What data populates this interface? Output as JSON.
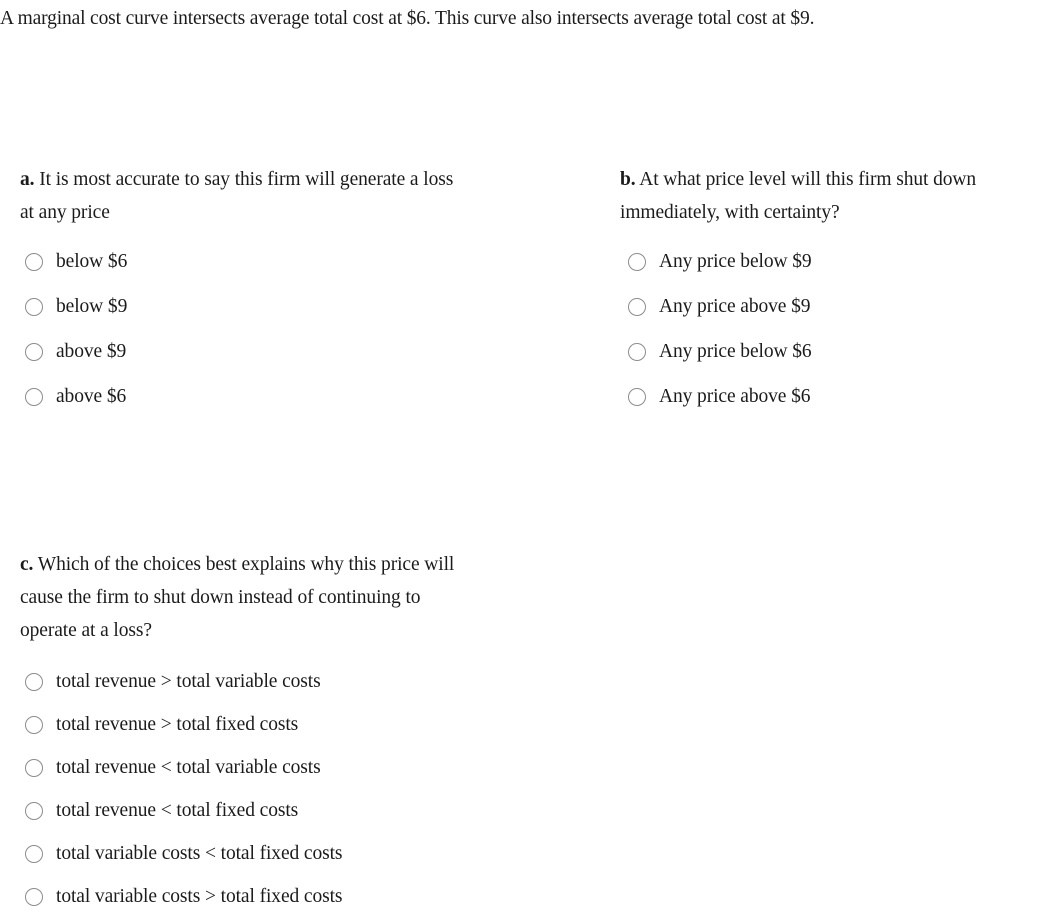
{
  "prompt": "A marginal cost curve intersects average total cost at $6. This curve also intersects average total cost at $9.",
  "questions": [
    {
      "tag": "a.",
      "stem_lines": [
        "It is most accurate to say this firm will generate a loss",
        "at any price"
      ],
      "options": [
        "below $6",
        "below $9",
        "above $9",
        "above $6"
      ]
    },
    {
      "tag": "b.",
      "stem_lines": [
        "At what price level will this firm shut down",
        "immediately, with certainty?"
      ],
      "options": [
        "Any price below $9",
        "Any price above $9",
        "Any price below $6",
        "Any price above $6"
      ]
    },
    {
      "tag": "c.",
      "stem_lines": [
        "Which of the choices best explains why this price will",
        "cause the firm to shut down instead of continuing to",
        "operate at a loss?"
      ],
      "options": [
        "total revenue > total variable costs",
        "total revenue > total fixed costs",
        "total revenue < total variable costs",
        "total revenue < total fixed costs",
        "total variable costs < total fixed costs",
        "total variable costs > total fixed costs"
      ]
    }
  ],
  "colors": {
    "background": "#ffffff",
    "text": "#1b1b1b",
    "radio_border": "#8c8c8c"
  }
}
